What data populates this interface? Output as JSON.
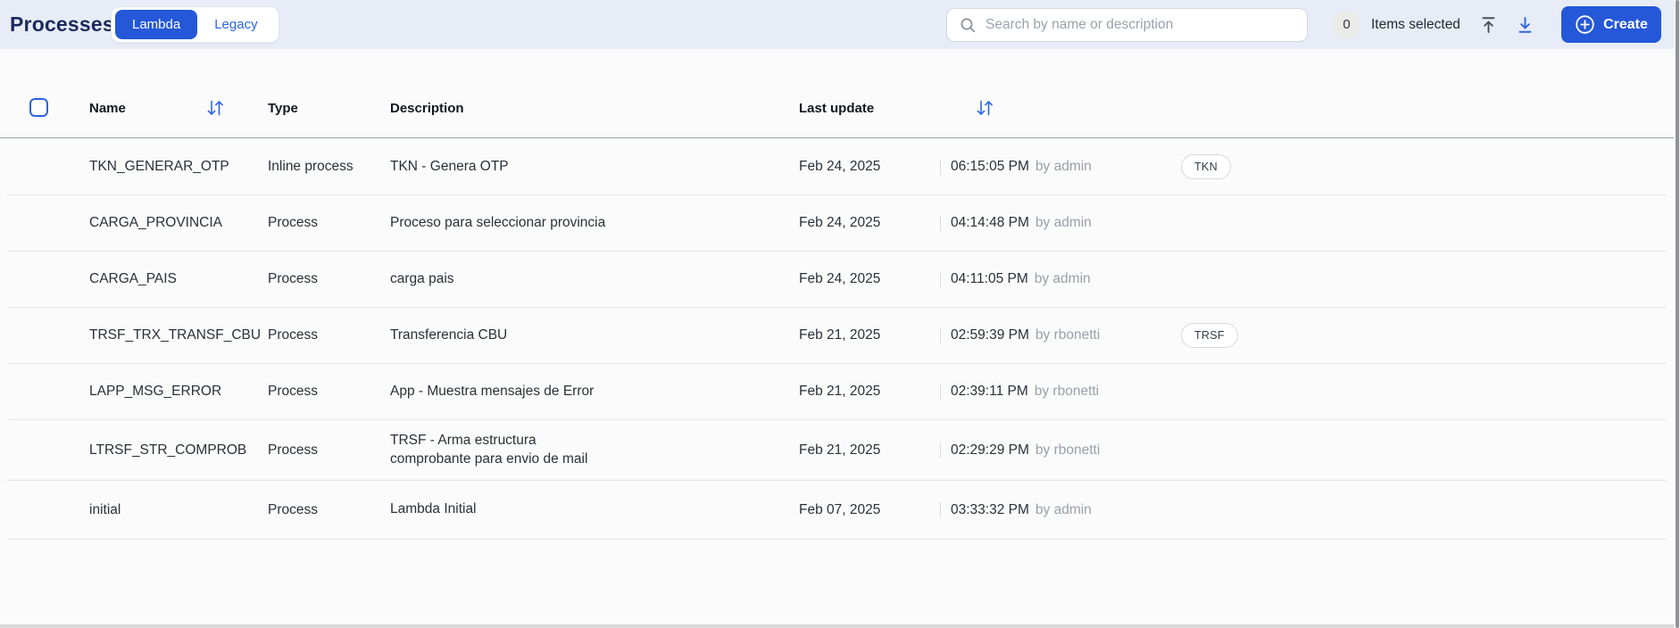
{
  "topbar": {
    "title": "Processes",
    "toggle": {
      "lambda": "Lambda",
      "legacy": "Legacy"
    },
    "search": {
      "placeholder": "Search by name or description"
    },
    "selected_count": "0",
    "selected_label": "Items selected",
    "create_label": "Create"
  },
  "table": {
    "columns": {
      "name": "Name",
      "type": "Type",
      "description": "Description",
      "last_update": "Last update"
    },
    "rows": [
      {
        "name": "TKN_GENERAR_OTP",
        "type": "Inline process",
        "description": "TKN - Genera OTP",
        "date": "Feb 24, 2025",
        "time": "06:15:05 PM",
        "by": "by admin",
        "tag": "TKN"
      },
      {
        "name": "CARGA_PROVINCIA",
        "type": "Process",
        "description": "Proceso para seleccionar provincia",
        "date": "Feb 24, 2025",
        "time": "04:14:48 PM",
        "by": "by admin",
        "tag": ""
      },
      {
        "name": "CARGA_PAIS",
        "type": "Process",
        "description": "carga pais",
        "date": "Feb 24, 2025",
        "time": "04:11:05 PM",
        "by": "by admin",
        "tag": ""
      },
      {
        "name": "TRSF_TRX_TRANSF_CBU",
        "type": "Process",
        "description": "Transferencia CBU",
        "date": "Feb 21, 2025",
        "time": "02:59:39 PM",
        "by": "by rbonetti",
        "tag": "TRSF"
      },
      {
        "name": "LAPP_MSG_ERROR",
        "type": "Process",
        "description": "App - Muestra mensajes de Error",
        "date": "Feb 21, 2025",
        "time": "02:39:11 PM",
        "by": "by rbonetti",
        "tag": ""
      },
      {
        "name": "LTRSF_STR_COMPROB",
        "type": "Process",
        "description": "TRSF - Arma estructura\ncomprobante para envio de mail",
        "date": "Feb 21, 2025",
        "time": "02:29:29 PM",
        "by": "by rbonetti",
        "tag": ""
      },
      {
        "name": "initial",
        "type": "Process",
        "description": "Lambda Initial",
        "date": "Feb 07, 2025",
        "time": "03:33:32 PM",
        "by": "by admin",
        "tag": ""
      }
    ]
  },
  "colors": {
    "accent_button": "#2458d8",
    "accent_link": "#2c66e2",
    "topbar_bg": "#e8ecf7",
    "title_text": "#1b2a5e",
    "table_bg": "#fbfbfc",
    "muted_text": "#99a0aa",
    "row_divider": "#e3e5e9",
    "head_divider": "#9aa0a9"
  }
}
